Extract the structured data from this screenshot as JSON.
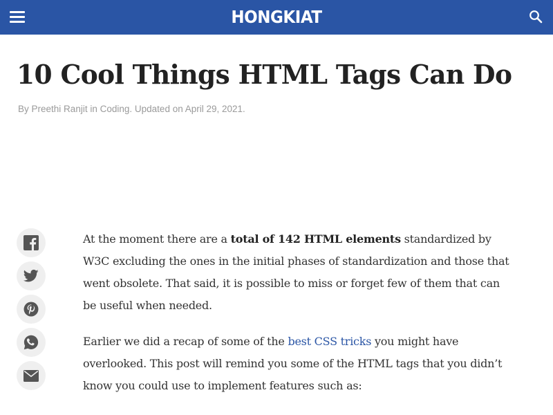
{
  "header": {
    "logo_text": "HONGKIAT",
    "background_color": "#2a55a5",
    "menu_icon": "hamburger-menu-icon",
    "search_icon": "search-icon"
  },
  "article": {
    "title": "10 Cool Things HTML Tags Can Do",
    "byline": {
      "prefix": "By",
      "author": "Preethi Ranjit",
      "in_word": "in",
      "category": "Coding",
      "updated_text": ". Updated on April 29, 2021."
    },
    "paragraph1": {
      "part1": "At the moment there are a ",
      "bold": "total of 142 HTML elements",
      "part2": " standardized by W3C excluding the ones in the initial phases of standardization and those that went obsolete. That said, it is possible to miss or forget few of them that can be useful when needed."
    },
    "paragraph2": {
      "part1": "Earlier we did a recap of some of the ",
      "link": "best CSS tricks",
      "part2": " you might have overlooked. This post will remind you some of the HTML tags that you didn’t know you could use to implement features such as:"
    }
  },
  "share_buttons": [
    {
      "icon": "facebook-icon"
    },
    {
      "icon": "twitter-icon"
    },
    {
      "icon": "pinterest-icon"
    },
    {
      "icon": "whatsapp-icon"
    },
    {
      "icon": "email-icon"
    }
  ],
  "colors": {
    "link": "#2a55a5",
    "meta_text": "#9a9a9a",
    "share_bg": "#efefef",
    "share_icon": "#555555"
  }
}
